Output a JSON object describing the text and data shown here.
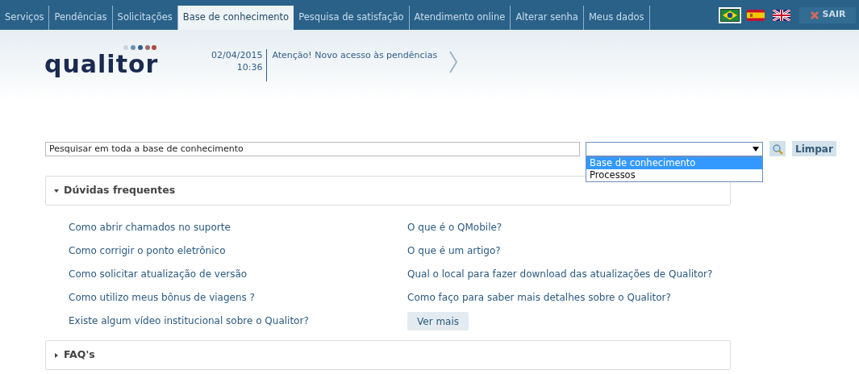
{
  "tabs": [
    {
      "label": "Serviços",
      "selected": false
    },
    {
      "label": "Pendências",
      "selected": false
    },
    {
      "label": "Solicitações",
      "selected": false
    },
    {
      "label": "Base de conhecimento",
      "selected": true
    },
    {
      "label": "Pesquisa de satisfação",
      "selected": false
    },
    {
      "label": "Atendimento online",
      "selected": false
    },
    {
      "label": "Alterar senha",
      "selected": false
    },
    {
      "label": "Meus dados",
      "selected": false
    }
  ],
  "languages": [
    {
      "kind": "brazil",
      "selected": true
    },
    {
      "kind": "spain",
      "selected": false
    },
    {
      "kind": "uk",
      "selected": false
    }
  ],
  "logout": "SAIR",
  "logo": "qualitor",
  "notice": {
    "date": "02/04/2015",
    "time": "10:36",
    "message": "Atenção! Novo acesso às pendências"
  },
  "search": {
    "value": "Pesquisar em toda a base de conhecimento",
    "scope_options": [
      {
        "label": "Base de conhecimento",
        "selected": true
      },
      {
        "label": "Processos",
        "selected": false
      }
    ],
    "clear": "Limpar"
  },
  "sections": [
    {
      "title": "Dúvidas frequentes",
      "expanded": true,
      "links": [
        "Como abrir chamados no suporte",
        "O que é o QMobile?",
        "Como corrigir o ponto eletrônico",
        "O que é um artigo?",
        "Como solicitar atualização de versão",
        "Qual o local para fazer download das atualizações de Qualitor?",
        "Como utilizo meus bônus de viagens ?",
        "Como faço para saber mais detalhes sobre o Qualitor?",
        "Existe algum vídeo institucional sobre o Qualitor?"
      ],
      "more": "Ver mais"
    },
    {
      "title": "FAQ's",
      "expanded": false
    }
  ]
}
